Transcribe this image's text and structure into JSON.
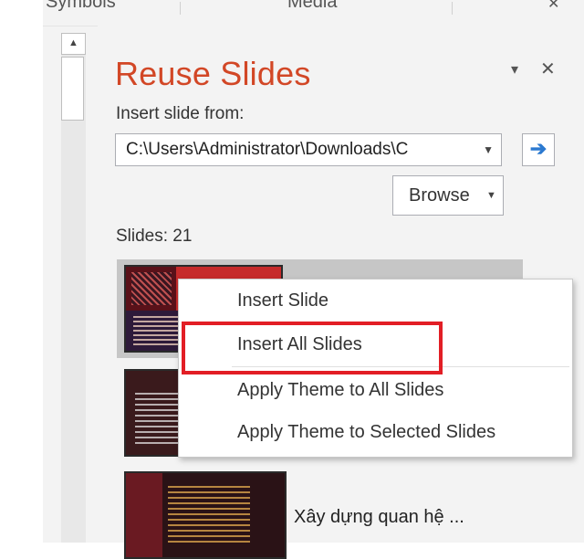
{
  "top_tabs": [
    "Symbols",
    "Media"
  ],
  "pane": {
    "title": "Reuse Slides",
    "menu_glyph": "▾",
    "close_glyph": "✕",
    "insert_from_label": "Insert slide from:",
    "path_value": "C:\\Users\\Administrator\\Downloads\\C",
    "browse_label": "Browse",
    "slides_count_label": "Slides: 21",
    "go_glyph": "➔"
  },
  "slides": [
    {
      "name": ""
    },
    {
      "name": ""
    },
    {
      "name": "Xây dựng quan hệ ..."
    }
  ],
  "context_menu": [
    "Insert Slide",
    "Insert All Slides",
    "Apply Theme to All Slides",
    "Apply Theme to Selected Slides"
  ],
  "highlighted_item": "Insert All Slides",
  "colors": {
    "title": "#d24726",
    "highlight_border": "#e21e25",
    "go_arrow": "#2b79d0",
    "selected_row": "#c6c6c6"
  },
  "icons": {
    "scroll_up": "scroll-up-icon",
    "pane_menu": "chevron-down-icon",
    "close": "close-icon",
    "go": "arrow-right-icon",
    "dropdown": "chevron-down-icon"
  }
}
